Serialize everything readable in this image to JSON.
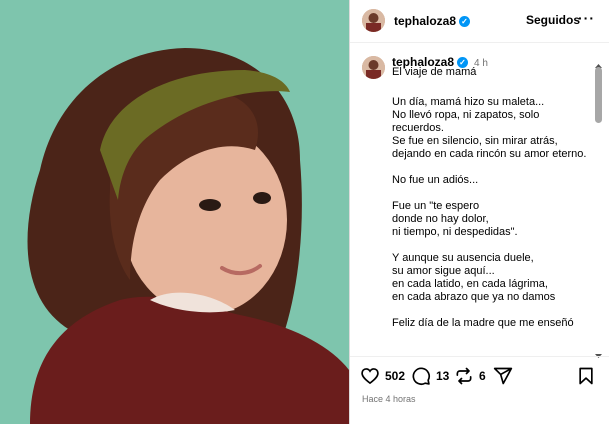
{
  "post": {
    "photo_alt": "Retrato de niña con diadema verde",
    "colors": {
      "background": "#7fc7af",
      "accent": "#0095f6",
      "muted": "#737373"
    }
  },
  "header": {
    "username": "tephaloza8",
    "follow_label": "Seguidos",
    "more_icon": "more-horizontal-icon"
  },
  "caption": {
    "username": "tephaloza8",
    "time": "4 h",
    "title": "El viaje de mamá",
    "body": "Un día, mamá hizo su maleta...\nNo llevó ropa, ni zapatos, solo recuerdos.\nSe fue en silencio, sin mirar atrás, dejando en cada rincón su amor eterno.\n\nNo fue un adiós...\n\nFue un \"te espero\ndonde no hay dolor,\nni tiempo, ni despedidas\".\n\nY aunque su ausencia duele,\nsu amor sigue aquí...\nen cada latido, en cada lágrima,\nen cada abrazo que ya no damos\n\nFeliz día de la madre que me enseñó"
  },
  "actions": {
    "likes": "502",
    "comments": "13",
    "reposts": "6",
    "icons": [
      "heart-icon",
      "comment-icon",
      "repost-icon",
      "share-icon",
      "bookmark-icon"
    ]
  },
  "footer": {
    "time": "Hace 4 horas"
  }
}
